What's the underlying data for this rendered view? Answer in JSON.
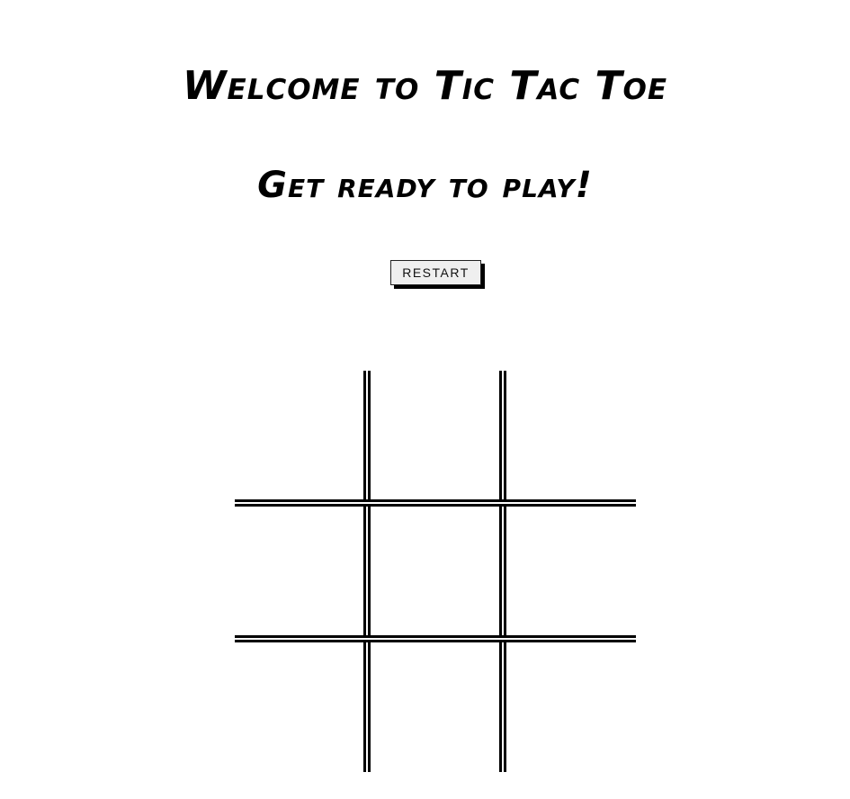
{
  "header": {
    "title": "Welcome to Tic Tac Toe",
    "subtitle": "Get ready to play!"
  },
  "controls": {
    "restart_label": "RESTART"
  },
  "board": {
    "cells": [
      "",
      "",
      "",
      "",
      "",
      "",
      "",
      "",
      ""
    ]
  }
}
